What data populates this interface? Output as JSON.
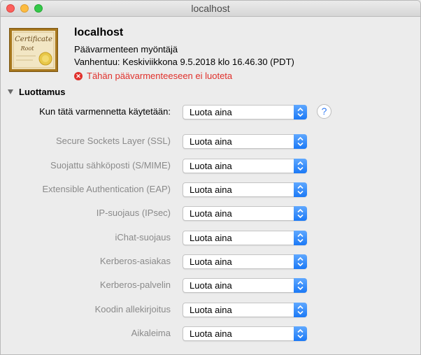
{
  "window": {
    "title": "localhost"
  },
  "certificate": {
    "icon_script": "Certificate",
    "icon_sub": "Root",
    "name": "localhost",
    "type": "Päävarmenteen myöntäjä",
    "expires": "Vanhentuu: Keskiviikkona 9.5.2018 klo 16.46.30 (PDT)",
    "warning": "Tähän päävarmenteeseen ei luoteta"
  },
  "trust": {
    "section_title": "Luottamus",
    "help_label": "?",
    "rows": [
      {
        "label": "Kun tätä varmennetta käytetään:",
        "value": "Luota aina"
      },
      {
        "label": "Secure Sockets Layer (SSL)",
        "value": "Luota aina"
      },
      {
        "label": "Suojattu sähköposti (S/MIME)",
        "value": "Luota aina"
      },
      {
        "label": "Extensible Authentication (EAP)",
        "value": "Luota aina"
      },
      {
        "label": "IP-suojaus (IPsec)",
        "value": "Luota aina"
      },
      {
        "label": "iChat-suojaus",
        "value": "Luota aina"
      },
      {
        "label": "Kerberos-asiakas",
        "value": "Luota aina"
      },
      {
        "label": "Kerberos-palvelin",
        "value": "Luota aina"
      },
      {
        "label": "Koodin allekirjoitus",
        "value": "Luota aina"
      },
      {
        "label": "Aikaleima",
        "value": "Luota aina"
      }
    ]
  },
  "colors": {
    "accent": "#1b79f6",
    "warning": "#e0302b"
  },
  "icons": [
    "certificate-icon",
    "warning-icon",
    "disclosure-triangle-icon",
    "popup-arrows-icon",
    "help-icon"
  ]
}
